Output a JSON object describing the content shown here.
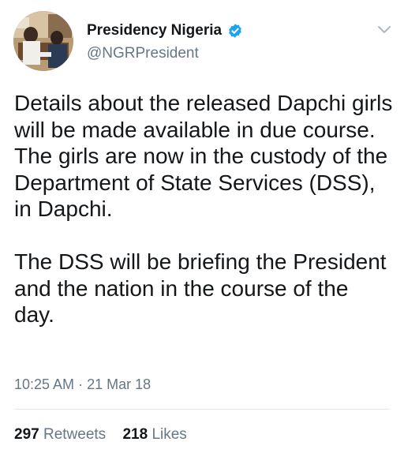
{
  "user": {
    "display_name": "Presidency Nigeria",
    "handle": "@NGRPresident",
    "verified": true
  },
  "tweet": {
    "paragraphs": [
      "Details about the released Dapchi girls will be made available in due course. The girls are now in the custody of the Department of State Services (DSS), in Dapchi.",
      "The DSS will be briefing the President and the nation in the course of the day."
    ],
    "time": "10:25 AM",
    "separator": "·",
    "date": "21 Mar 18"
  },
  "stats": {
    "retweets_count": "297",
    "retweets_label": "Retweets",
    "likes_count": "218",
    "likes_label": "Likes"
  },
  "icons": {
    "verified": "verified-badge-icon",
    "menu": "chevron-down-icon"
  },
  "colors": {
    "verified_blue": "#1da1f2",
    "secondary_text": "#657786",
    "primary_text": "#14171a",
    "divider": "#e1e8ed"
  }
}
